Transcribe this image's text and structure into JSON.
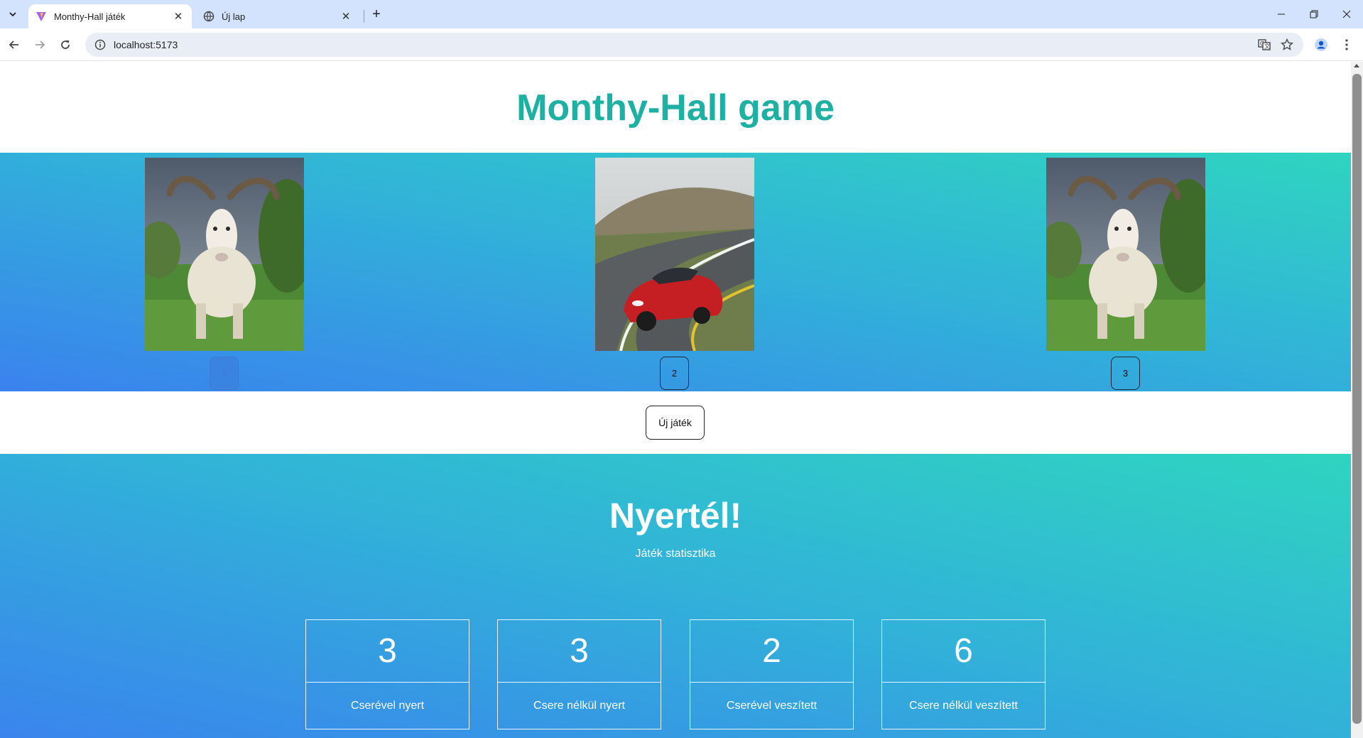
{
  "browser": {
    "tabs": [
      {
        "title": "Monthy-Hall játék",
        "active": true
      },
      {
        "title": "Új lap",
        "active": false
      }
    ],
    "url": "localhost:5173"
  },
  "page": {
    "title": "Monthy-Hall game",
    "doors": [
      {
        "button_label": "1",
        "content": "goat",
        "disabled": true
      },
      {
        "button_label": "2",
        "content": "car",
        "disabled": false
      },
      {
        "button_label": "3",
        "content": "goat",
        "disabled": false
      }
    ],
    "new_game_label": "Új játék",
    "result_text": "Nyertél!",
    "stats_subtitle": "Játék statisztika",
    "stats": [
      {
        "value": "3",
        "label": "Cserével nyert"
      },
      {
        "value": "3",
        "label": "Csere nélkül nyert"
      },
      {
        "value": "2",
        "label": "Cserével veszített"
      },
      {
        "value": "6",
        "label": "Csere nélkül veszített"
      }
    ]
  },
  "colors": {
    "title": "#1fb0a4",
    "gradient_start": "#3a82ee",
    "gradient_end": "#2fd4c0"
  }
}
